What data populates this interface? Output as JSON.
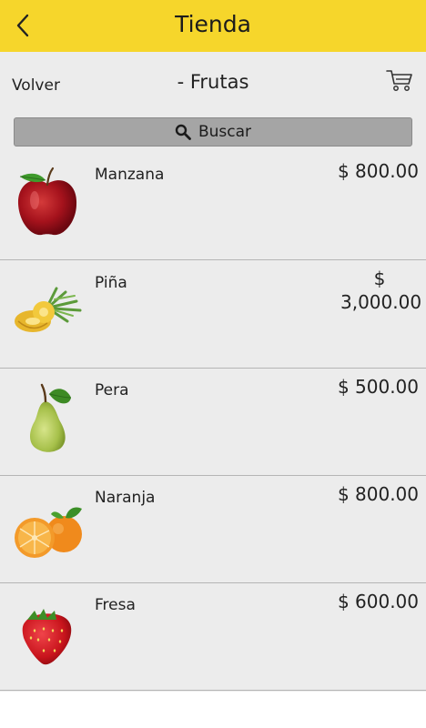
{
  "header": {
    "title": "Tienda"
  },
  "subbar": {
    "back_label": "Volver",
    "category": "- Frutas"
  },
  "search": {
    "label": "Buscar"
  },
  "products": [
    {
      "name": "Manzana",
      "price": "$ 800.00"
    },
    {
      "name": "Piña",
      "price": "$ 3,000.00"
    },
    {
      "name": "Pera",
      "price": "$ 500.00"
    },
    {
      "name": "Naranja",
      "price": "$ 800.00"
    },
    {
      "name": "Fresa",
      "price": "$ 600.00"
    }
  ],
  "colors": {
    "header": "#f6d62b",
    "background": "#ececec",
    "search_bar": "#a5a5a5"
  }
}
